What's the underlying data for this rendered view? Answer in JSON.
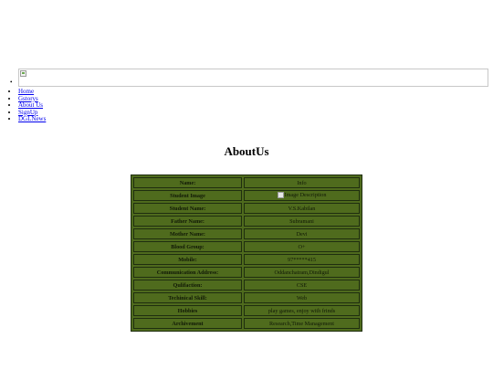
{
  "nav": {
    "items": [
      {
        "label": "Home"
      },
      {
        "label": "Gstorys"
      },
      {
        "label": "About Us"
      },
      {
        "label": "SignUp"
      },
      {
        "label": "DGLNews"
      }
    ]
  },
  "page": {
    "title": "AboutUs"
  },
  "profile": {
    "rows": [
      {
        "label": "Name:",
        "value": "Info"
      },
      {
        "label": "Student Image",
        "value": "Image Description"
      },
      {
        "label": "Student Name:",
        "value": "V.S.Kabilan"
      },
      {
        "label": "Father Name:",
        "value": "Subramani"
      },
      {
        "label": "Mother Name:",
        "value": "Devi"
      },
      {
        "label": "Blood Group:",
        "value": "O+"
      },
      {
        "label": "Mobile:",
        "value": "97*****415"
      },
      {
        "label": "Communication Address:",
        "value": "Oddanchatram,Dindigul"
      },
      {
        "label": "Qulifaction:",
        "value": "CSE"
      },
      {
        "label": "Techinical Skill:",
        "value": "Web"
      },
      {
        "label": "Hobbies",
        "value": "play games, enjoy with frinds"
      },
      {
        "label": "Archivement",
        "value": "Research,Time Management"
      }
    ]
  },
  "colors": {
    "table_bg": "#4f6b1d",
    "border": "#1f2e0f",
    "link": "#0000ee"
  }
}
